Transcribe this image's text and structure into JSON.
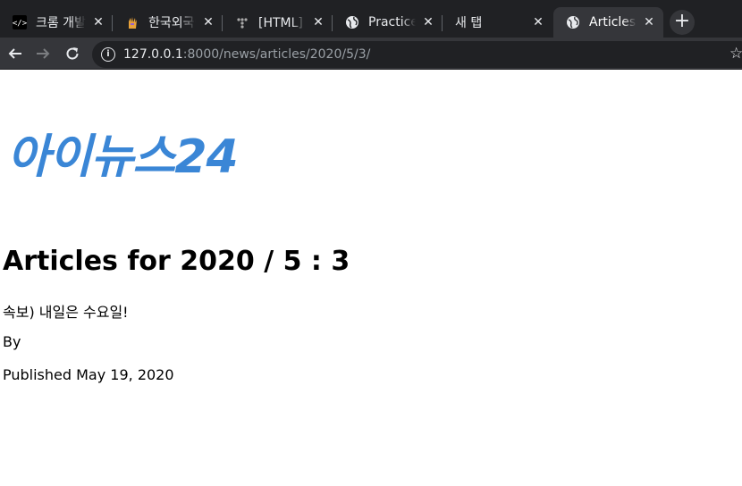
{
  "browser": {
    "tabs": [
      {
        "title": "크롬 개발",
        "icon": "devtools-icon",
        "active": false
      },
      {
        "title": "한국외국어",
        "icon": "hand-logo-icon",
        "active": false
      },
      {
        "title": "[HTML] 태",
        "icon": "tistory-icon",
        "active": false
      },
      {
        "title": "Practice_",
        "icon": "globe-icon",
        "active": false
      },
      {
        "title": "새 탭",
        "icon": "",
        "active": false
      },
      {
        "title": "Articles fo",
        "icon": "globe-icon",
        "active": true
      }
    ],
    "close_glyph": "✕",
    "new_tab_glyph": "+",
    "address": {
      "host": "127.0.0.1",
      "rest": ":8000/news/articles/2020/5/3/"
    }
  },
  "page": {
    "logo": "아이뉴스24",
    "heading": "Articles for 2020 / 5 : 3",
    "article_title": "속보) 내일은 수요일!",
    "byline": "By",
    "published": "Published May 19, 2020"
  },
  "colors": {
    "logo": "#3a86d6",
    "tabstrip": "#202124",
    "toolbar": "#35363a"
  }
}
